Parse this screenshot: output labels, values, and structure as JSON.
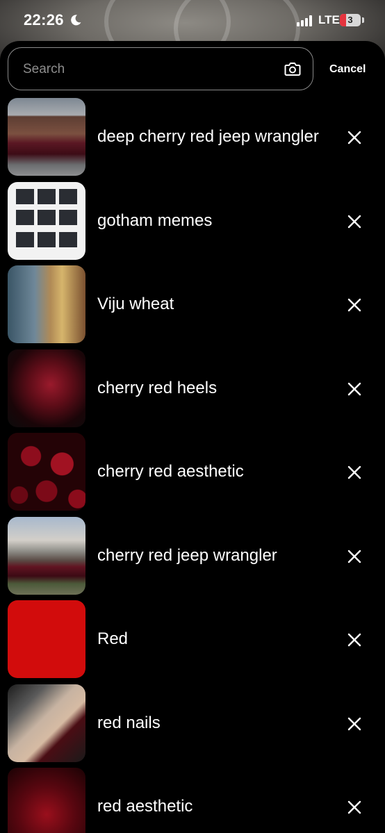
{
  "status_bar": {
    "time": "22:26",
    "network": "LTE",
    "battery_level": "3",
    "icons": [
      "moon-icon",
      "signal-icon",
      "battery-icon"
    ]
  },
  "search": {
    "placeholder": "Search",
    "camera_icon": "camera-icon",
    "cancel_label": "Cancel"
  },
  "recent_searches": [
    {
      "label": "deep cherry red jeep wrangler"
    },
    {
      "label": "gotham memes"
    },
    {
      "label": "Viju wheat"
    },
    {
      "label": "cherry red heels"
    },
    {
      "label": "cherry red aesthetic"
    },
    {
      "label": "cherry red jeep wrangler"
    },
    {
      "label": "Red"
    },
    {
      "label": "red nails"
    },
    {
      "label": "red aesthetic"
    }
  ],
  "remove_icon": "close-icon",
  "colors": {
    "background": "#000000",
    "text": "#ffffff",
    "search_border": "#8a8a8a",
    "placeholder": "#8d8d8d",
    "red_swatch": "#d20c0c"
  }
}
